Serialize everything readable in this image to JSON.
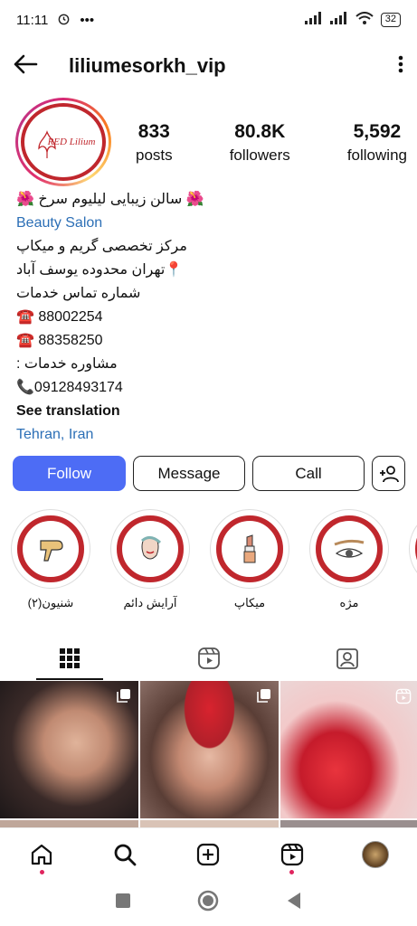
{
  "status": {
    "time": "11:11",
    "battery": "32"
  },
  "header": {
    "username": "liliumesorkh_vip"
  },
  "profile": {
    "logo_text": "RED Lilium",
    "stats": [
      {
        "value": "833",
        "label": "posts"
      },
      {
        "value": "80.8K",
        "label": "followers"
      },
      {
        "value": "5,592",
        "label": "following"
      }
    ]
  },
  "bio": {
    "name_line": "🌺 سالن زیبایی لیلیوم سرخ 🌺",
    "category": "Beauty Salon",
    "lines": [
      "مرکز تخصصی گریم و میکاپ",
      "📍تهران محدوده یوسف آباد",
      "شماره تماس خدمات",
      "☎️ 88002254",
      "☎️ 88358250",
      "مشاوره خدمات :",
      "📞09128493174"
    ],
    "see_translation": "See translation",
    "location": "Tehran, Iran"
  },
  "actions": {
    "follow": "Follow",
    "message": "Message",
    "call": "Call"
  },
  "highlights": [
    {
      "label": "شنیون(۲)",
      "icon": "hair-dryer-icon"
    },
    {
      "label": "آرایش دائم",
      "icon": "face-icon"
    },
    {
      "label": "میکاپ",
      "icon": "lipstick-icon"
    },
    {
      "label": "مژه",
      "icon": "eye-icon"
    }
  ],
  "colors": {
    "accent": "#4d6cf5",
    "brand_red": "#c0272d",
    "link": "#2c6fb6"
  }
}
